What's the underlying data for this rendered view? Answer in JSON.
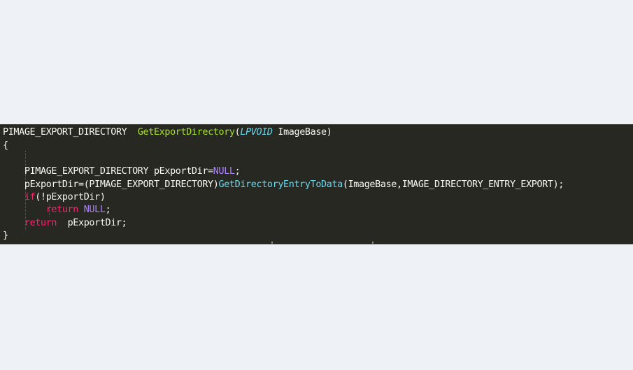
{
  "code": {
    "line1": {
      "return_type": "PIMAGE_EXPORT_DIRECTORY",
      "gap": "  ",
      "function_name": "GetExportDirectory",
      "open_paren": "(",
      "param_type": "LPVOID",
      "param_name": " ImageBase)"
    },
    "line2": {
      "brace": "{"
    },
    "line3": {
      "indent": "    ",
      "decl": "PIMAGE_EXPORT_DIRECTORY pExportDir=",
      "null_value": "NULL",
      "end": ";"
    },
    "line4": {
      "indent": "    ",
      "assign": "pExportDir=(PIMAGE_EXPORT_DIRECTORY)",
      "call_name": "GetDirectoryEntryToData",
      "args": "(ImageBase,IMAGE_DIRECTORY_ENTRY_EXPORT);"
    },
    "line5": {
      "indent": "    ",
      "keyword": "if",
      "condition": "(!pExportDir)"
    },
    "line6": {
      "indent": "        ",
      "keyword": "return",
      "space": " ",
      "null_value": "NULL",
      "end": ";"
    },
    "line7": {
      "indent": "    ",
      "keyword": "return",
      "rest": "  pExportDir;"
    },
    "line8": {
      "brace": "}"
    }
  },
  "colors": {
    "editor_background": "#272822",
    "page_background": "#eef1f6",
    "default_text": "#f8f8f2",
    "function_name": "#a6e22e",
    "type_and_call": "#66d9ef",
    "constant": "#ae81ff",
    "keyword": "#f92672"
  }
}
